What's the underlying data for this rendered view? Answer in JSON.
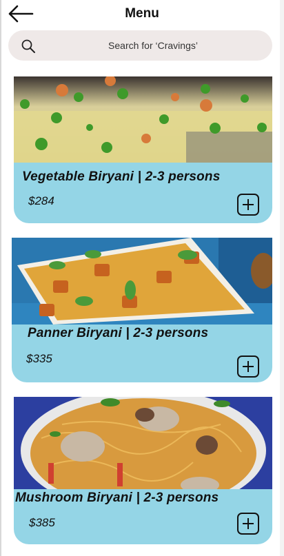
{
  "header": {
    "title": "Menu",
    "back_icon": "arrow-left-icon"
  },
  "search": {
    "placeholder": "Search for ‘Cravings’",
    "icon": "search-icon"
  },
  "colors": {
    "card": "#94d5e6",
    "search_bg": "#efe9e8",
    "text": "#111111"
  },
  "menu": {
    "items": [
      {
        "name": "Vegetable Biryani  | 2-3 persons",
        "price": "$284",
        "image": "vegetable-biryani-photo",
        "add_icon": "plus-square-icon"
      },
      {
        "name": "Panner Biryani  | 2-3 persons",
        "price": "$335",
        "image": "paneer-biryani-photo",
        "add_icon": "plus-square-icon"
      },
      {
        "name": "Mushroom Biryani  | 2-3 persons",
        "price": "$385",
        "image": "mushroom-biryani-photo",
        "add_icon": "plus-square-icon"
      }
    ]
  }
}
